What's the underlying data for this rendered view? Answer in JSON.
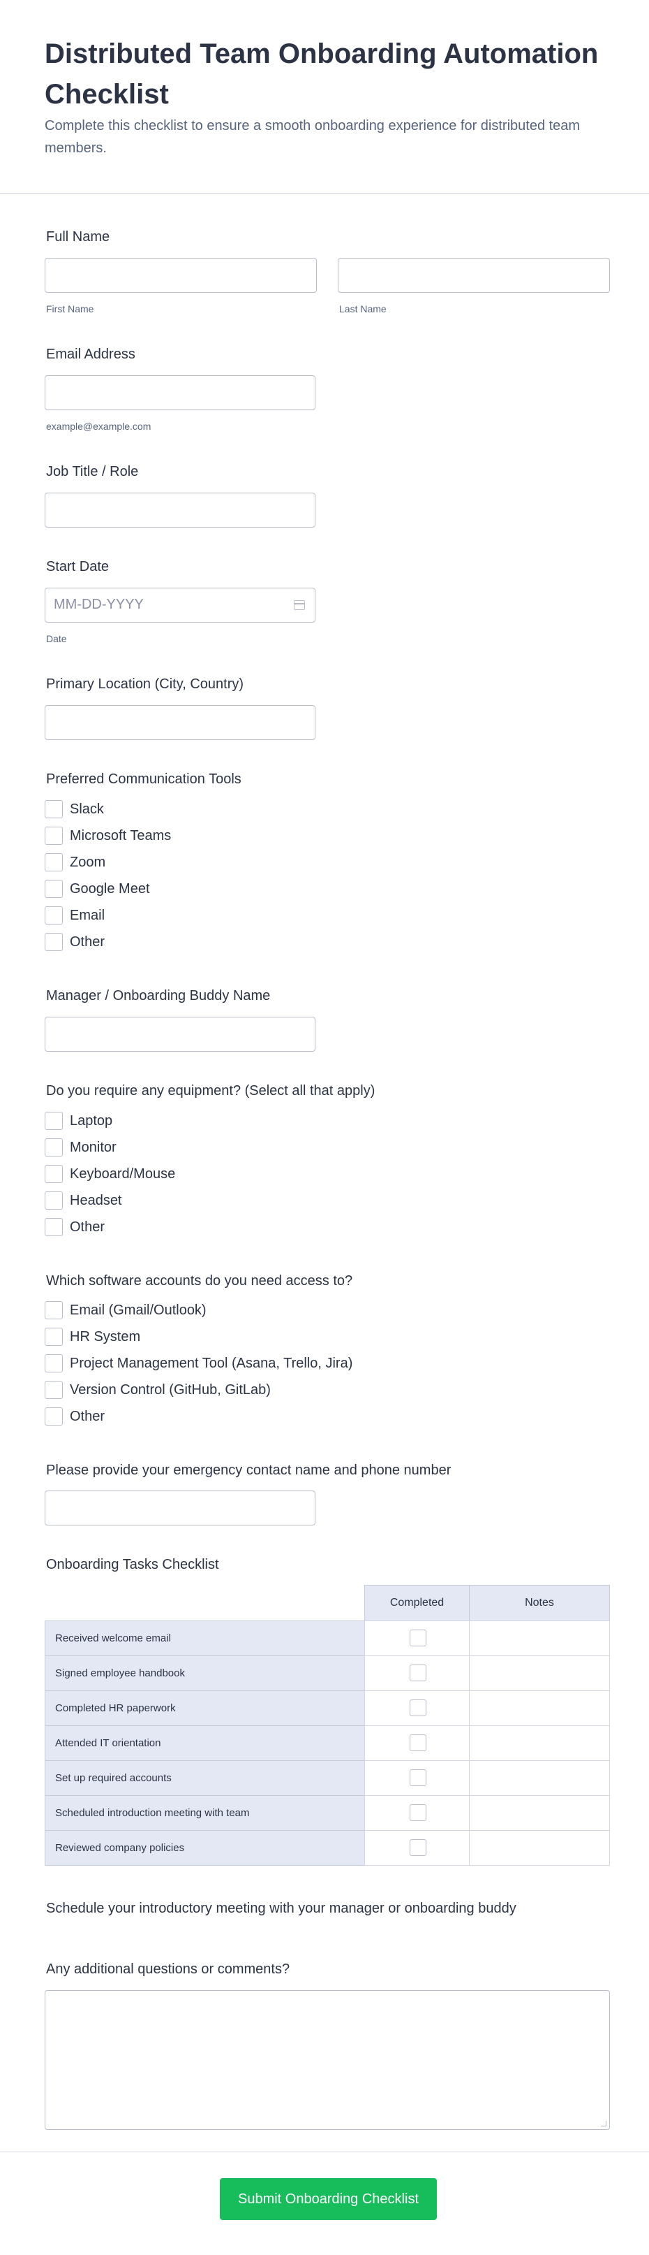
{
  "form": {
    "title": "Distributed Team Onboarding Automation Checklist",
    "subtitle": "Complete this checklist to ensure a smooth onboarding experience for distributed team members.",
    "full_name": {
      "label": "Full Name",
      "first_sub": "First Name",
      "last_sub": "Last Name"
    },
    "email": {
      "label": "Email Address",
      "sub": "example@example.com"
    },
    "job_title": {
      "label": "Job Title / Role"
    },
    "start_date": {
      "label": "Start Date",
      "placeholder": "MM-DD-YYYY",
      "sub": "Date"
    },
    "location": {
      "label": "Primary Location (City, Country)"
    },
    "comm_tools": {
      "label": "Preferred Communication Tools",
      "options": [
        "Slack",
        "Microsoft Teams",
        "Zoom",
        "Google Meet",
        "Email",
        "Other"
      ]
    },
    "manager": {
      "label": "Manager / Onboarding Buddy Name"
    },
    "equipment": {
      "label": "Do you require any equipment? (Select all that apply)",
      "options": [
        "Laptop",
        "Monitor",
        "Keyboard/Mouse",
        "Headset",
        "Other"
      ]
    },
    "software": {
      "label": "Which software accounts do you need access to?",
      "options": [
        "Email (Gmail/Outlook)",
        "HR System",
        "Project Management Tool (Asana, Trello, Jira)",
        "Version Control (GitHub, GitLab)",
        "Other"
      ]
    },
    "emergency": {
      "label": "Please provide your emergency contact name and phone number"
    },
    "tasks": {
      "label": "Onboarding Tasks Checklist",
      "columns": [
        "Completed",
        "Notes"
      ],
      "rows": [
        "Received welcome email",
        "Signed employee handbook",
        "Completed HR paperwork",
        "Attended IT orientation",
        "Set up required accounts",
        "Scheduled introduction meeting with team",
        "Reviewed company policies"
      ]
    },
    "schedule": {
      "label": "Schedule your introductory meeting with your manager or onboarding buddy"
    },
    "comments": {
      "label": "Any additional questions or comments?"
    },
    "submit_label": "Submit Onboarding Checklist"
  },
  "colors": {
    "accent": "#18bd5b",
    "matrix_header": "#e4e8f4",
    "text": "#2c3345",
    "subtext": "#57647e"
  }
}
